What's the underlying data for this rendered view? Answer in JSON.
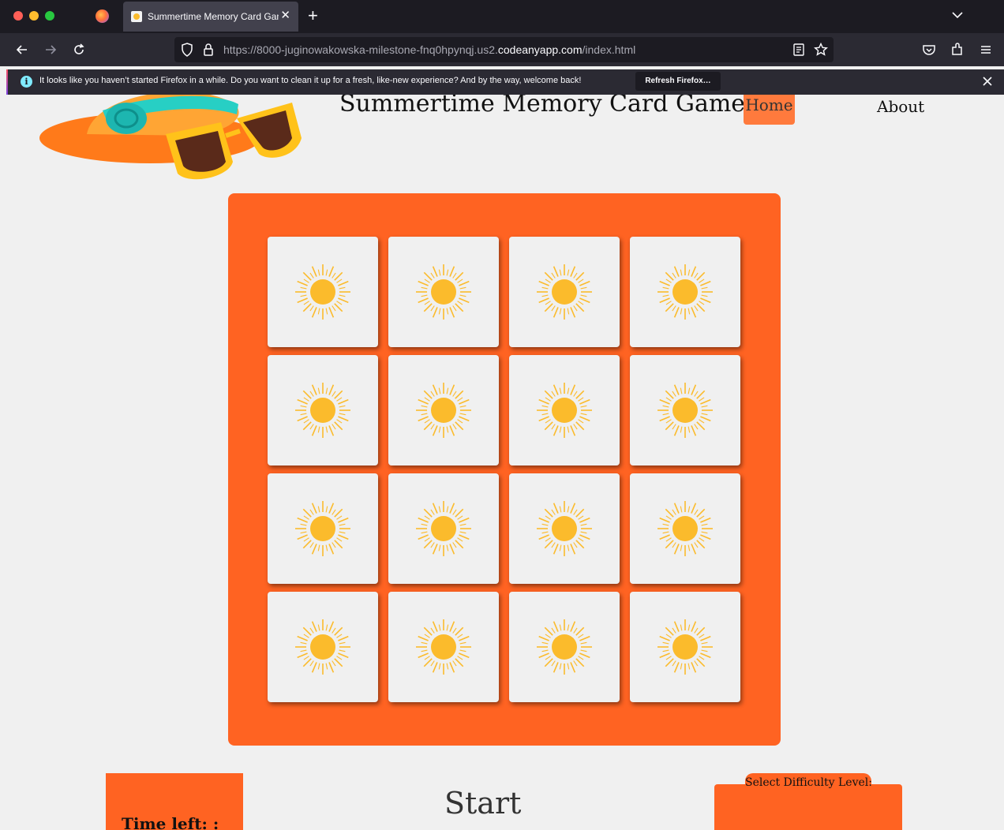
{
  "browser": {
    "tab_title": "Summertime Memory Card Game",
    "tab_close": "✕",
    "new_tab": "+",
    "url_prefix": "https://8000-juginowakowska-milestone-fnq0hpynqj.us2.",
    "url_host": "codeanyapp.com",
    "url_suffix": "/index.html",
    "notice_text": "It looks like you haven’t started Firefox in a while. Do you want to clean it up for a fresh, like-new experience? And by the way, welcome back!",
    "notice_button": "Refresh Firefox…",
    "notice_icon": "i"
  },
  "site": {
    "title": "Summertime Memory Card Game",
    "nav": {
      "home": "Home",
      "about": "About"
    }
  },
  "game": {
    "cards": 16,
    "card_face": "sun-icon",
    "timer_label": "Time left:   :",
    "start_label": "Start",
    "difficulty_label": "Select Difficulty Level:"
  },
  "colors": {
    "accent": "#ff6322",
    "nav_active": "#ff7a3d",
    "sun": "#fbbb2c",
    "page_bg": "#f0f0f0"
  }
}
